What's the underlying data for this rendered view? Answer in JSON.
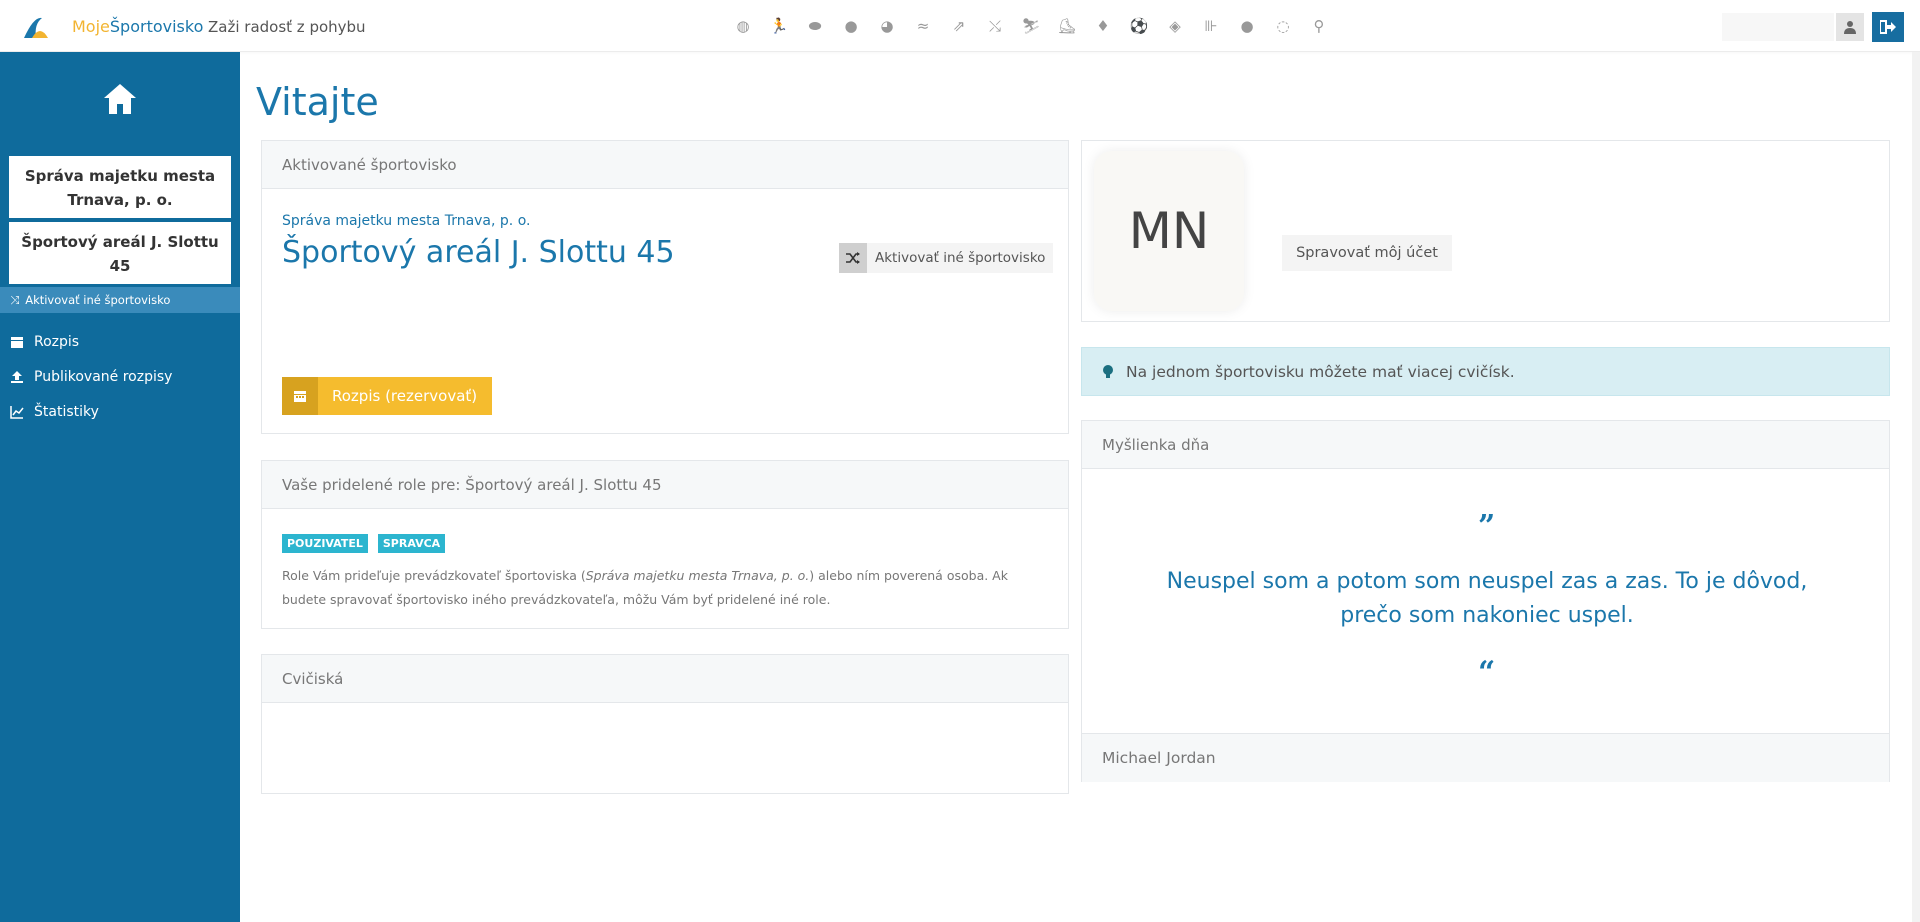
{
  "brand": {
    "part1": "Moje",
    "part2": "Športovisko",
    "tagline": "Zaži radosť z pohybu"
  },
  "header": {
    "sport_icons": [
      "volleyball-icon",
      "running-icon",
      "hockey-puck-icon",
      "basketball-icon",
      "ball-icon",
      "swimming-icon",
      "sprint-icon",
      "athletics-icon",
      "skiing-icon",
      "skating-icon",
      "lightbulb-icon",
      "soccer-icon",
      "rugby-icon",
      "fitness-icon",
      "ball2-icon",
      "tennis-icon",
      "cycling-icon"
    ],
    "colors": {
      "accent": "#1b77ab",
      "brand_yellow": "#f2b431"
    }
  },
  "sidebar": {
    "org": "Správa majetku mesta Trnava, p. o.",
    "venue": "Športový areál J. Slottu 45",
    "switch_label": "Aktivovať iné športovisko",
    "items": [
      {
        "label": "Rozpis",
        "icon": "calendar-icon"
      },
      {
        "label": "Publikované rozpisy",
        "icon": "upload-icon"
      },
      {
        "label": "Štatistiky",
        "icon": "chart-icon"
      }
    ]
  },
  "main": {
    "title": "Vitajte",
    "activated": {
      "heading": "Aktivované športovisko",
      "org": "Správa majetku mesta Trnava, p. o.",
      "venue": "Športový areál J. Slottu 45",
      "activate_other": "Aktivovať iné športovisko",
      "book_button": "Rozpis (rezervovať)"
    },
    "roles": {
      "heading": "Vaše pridelené role pre: Športový areál J. Slottu 45",
      "badges": [
        "POUZIVATEL",
        "SPRAVCA"
      ],
      "text_pre": "Role Vám prideľuje prevádzkovateľ športoviska (",
      "text_org": "Správa majetku mesta Trnava, p. o.",
      "text_post": ") alebo ním poverená osoba. Ak budete spravovať športovisko iného prevádzkovateľa, môžu Vám byť pridelené iné role."
    },
    "gyms": {
      "heading": "Cvičiská"
    },
    "account": {
      "initials": "MN",
      "manage_button": "Spravovať môj účet"
    },
    "tip": {
      "text": "Na jednom športovisku môžete mať viacej cvičísk."
    },
    "quote": {
      "heading": "Myšlienka dňa",
      "open_mark": "”",
      "close_mark": "“",
      "text": "Neuspel som a potom som neuspel zas a zas. To je dôvod, prečo som nakoniec uspel.",
      "author": "Michael Jordan"
    }
  }
}
